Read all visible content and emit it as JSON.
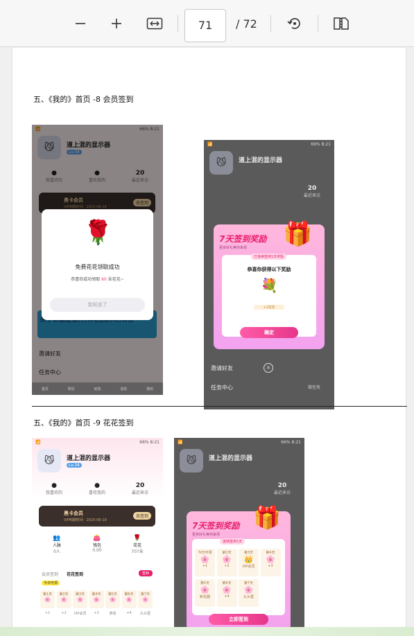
{
  "toolbar": {
    "zoom_out_icon": "minus-icon",
    "zoom_in_icon": "plus-icon",
    "fit_icon": "fit-width-icon",
    "current_page": "71",
    "total_pages": "/ 72",
    "rotate_icon": "rotate-icon",
    "twopage_icon": "two-page-icon"
  },
  "document": {
    "heading1": "五、《我的》首页 -8 会员签到",
    "heading2": "五、《我的》首页 -9 花花签到"
  },
  "phone_common": {
    "username": "道上混的显示器",
    "level": "Lv.34",
    "stat_left_label": "我喜欢的",
    "stat_mid_label": "喜欢我的",
    "stat_right_value": "20",
    "stat_right_label": "最近来访",
    "status_left": "📶",
    "status_right": "66% 8:21"
  },
  "screen1": {
    "vip_title": "黑卡会员",
    "vip_sub": "VIP到期时间 · 2025-06-19",
    "vip_btn": "去签到",
    "modal_title": "免费花花领取成功",
    "modal_text_a": "恭喜你成功领取",
    "modal_num": "60",
    "modal_text_b": "朵花花~",
    "modal_btn": "我知道了",
    "banner": "关于新国证或行为风险提示的公告",
    "invite": "邀请好友",
    "task": "任务中心",
    "tabs": [
      "首页",
      "附近",
      "动态",
      "消息",
      "我的"
    ]
  },
  "screen2": {
    "gift_title": "7天签到奖励",
    "gift_sub": "更多好礼等你来领",
    "gift_badge": "已连续签到1天奖励",
    "gift_msg": "恭喜你获得以下奖励",
    "gift_item": "+1花花",
    "gift_btn": "确定",
    "invite": "邀请好友",
    "task": "任务中心",
    "task_right": "做任务"
  },
  "screen3": {
    "vip_title": "黑卡会员",
    "vip_sub": "VIP到期时间 · 2025-06-19",
    "vip_btn": "去签到",
    "feat1": "人脉",
    "feat1_sub": "0人",
    "feat2": "钱包",
    "feat2_sub": "0.00",
    "feat3": "花花",
    "feat3_sub": "707朵",
    "sign_tab1": "会员签到",
    "sign_tab2": "花花签到",
    "sign_btn": "签到",
    "today": "今日可领",
    "days": [
      "第1天",
      "第2天",
      "第3天",
      "第4天",
      "第5天",
      "第6天",
      "第7天"
    ],
    "rewards": [
      "+1",
      "+2",
      "VIP会员",
      "+3",
      "表情",
      "+4",
      "头头框"
    ]
  },
  "screen4": {
    "gift_title": "7天签到奖励",
    "gift_sub": "更多好礼等你来领",
    "gift_badge": "连续签到1天",
    "cells": [
      "今日可领",
      "第2天",
      "第3天",
      "第4天",
      "第5天",
      "第6天",
      "第7天"
    ],
    "cell_vals": [
      "+1",
      "+2",
      "VIP会员",
      "+3",
      "新花圈",
      "+4",
      "头头框"
    ],
    "gift_btn": "立即签到"
  },
  "colors": {
    "accent_pink": "#e8206b",
    "vip_dark": "#3a2f2a",
    "level_blue": "#5aa0e8"
  }
}
